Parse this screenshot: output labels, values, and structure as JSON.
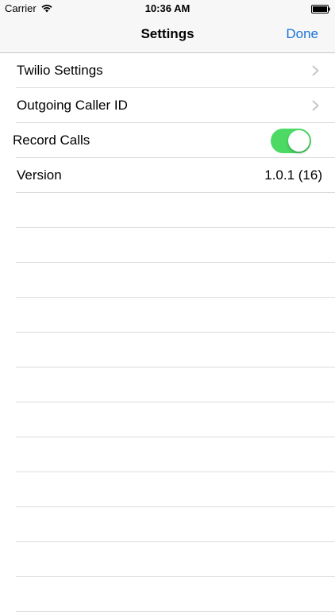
{
  "status_bar": {
    "carrier": "Carrier",
    "time": "10:36 AM"
  },
  "nav": {
    "title": "Settings",
    "done_label": "Done"
  },
  "rows": [
    {
      "label": "Twilio Settings",
      "accessory": "chevron-icon"
    },
    {
      "label": "Outgoing Caller ID",
      "accessory": "chevron-icon"
    },
    {
      "label": "Record Calls",
      "accessory": "toggle",
      "toggle_on": true
    },
    {
      "label": "Version",
      "value": "1.0.1 (16)"
    }
  ],
  "colors": {
    "accent": "#1a73d9",
    "toggle_on": "#4cd964",
    "separator": "#dcdce0",
    "bar_background": "#f7f7f7"
  }
}
